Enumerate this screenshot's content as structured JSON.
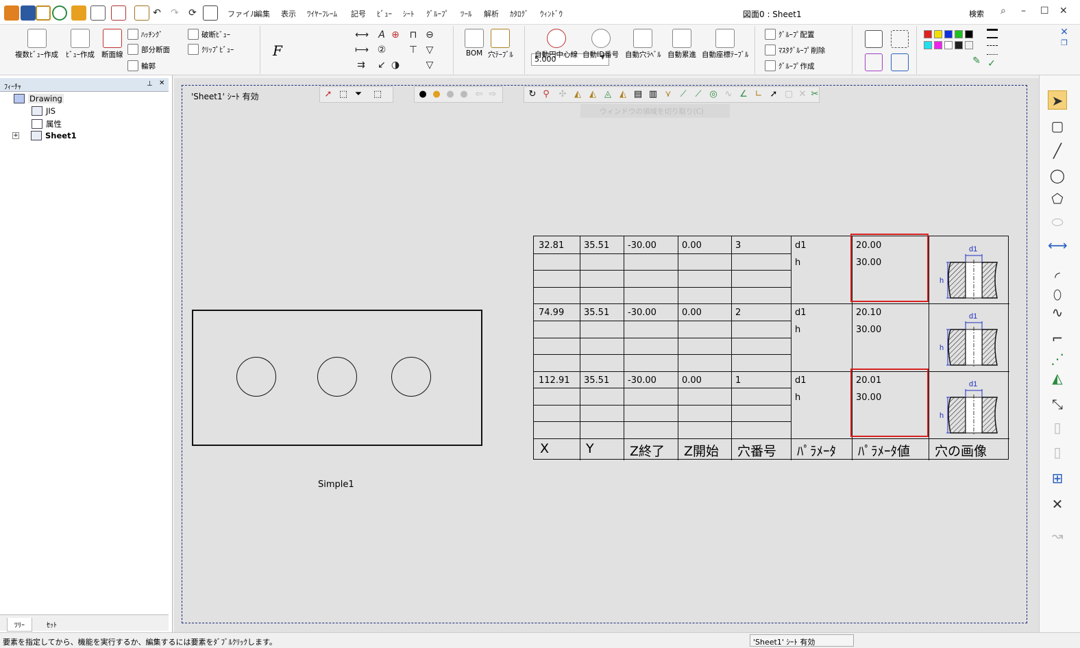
{
  "titlebar": {
    "document_title": "図面0 : Sheet1",
    "search_label": "検索",
    "menu": [
      "ファイル",
      "編集",
      "表示",
      "ﾜｲﾔｰﾌﾚｰﾑ",
      "記号",
      "ﾋﾞｭｰ",
      "ｼｰﾄ",
      "ｸﾞﾙｰﾌﾟ",
      "ﾂｰﾙ",
      "解析",
      "ｶﾀﾛｸﾞ",
      "ｳｨﾝﾄﾞｳ"
    ]
  },
  "ribbon": {
    "multi_view": "複数ﾋﾞｭｰ作成",
    "view_create": "ﾋﾞｭｰ作成",
    "section_line": "断面線",
    "hatching": "ﾊｯﾁﾝｸﾞ",
    "partial_section": "部分断面",
    "contour": "輪郭",
    "broken_view": "破断ﾋﾞｭｰ",
    "clip_view": "ｸﾘｯﾌﾟﾋﾞｭｰ",
    "scale_value": "5.000",
    "font_button": "F",
    "bom": "BOM",
    "hole_table": "穴ﾃｰﾌﾞﾙ",
    "auto_center": "自動円中心線",
    "auto_id": "自動ID番号",
    "auto_hole_label": "自動穴ﾗﾍﾞﾙ",
    "auto_ordinate": "自動累進",
    "auto_coord_table": "自動座標ﾃｰﾌﾞﾙ",
    "group_place": "ｸﾞﾙｰﾌﾟ配置",
    "master_group_delete": "ﾏｽﾀｸﾞﾙｰﾌﾟ削除",
    "group_create": "ｸﾞﾙｰﾌﾟ作成",
    "colors": [
      "#e02020",
      "#f0e000",
      "#1030e0",
      "#20c020",
      "#000000",
      "#20e0f0",
      "#f020f0",
      "#ffffff",
      "#202020",
      "#f0f0f0"
    ]
  },
  "feature_panel": {
    "title": "ﾌｨｰﾁｬ",
    "tree": [
      {
        "label": "Drawing",
        "icon": "drawing-icon"
      },
      {
        "label": "JIS",
        "icon": "standard-icon"
      },
      {
        "label": "属性",
        "icon": "attributes-icon"
      },
      {
        "label": "Sheet1",
        "icon": "sheet-icon"
      }
    ],
    "tabs": [
      "ﾂﾘｰ",
      "ｾｯﾄ"
    ]
  },
  "canvas": {
    "sheet_label": "'Sheet1' ｼｰﾄ 有効",
    "ghost_hint": "ウィンドウの領域を切り取り(C)",
    "view_name": "Simple1"
  },
  "hole_table": {
    "headers": [
      "X",
      "Y",
      "Z終了",
      "Z開始",
      "穴番号",
      "ﾊﾟﾗﾒｰﾀ",
      "ﾊﾟﾗﾒｰﾀ値",
      "穴の画像"
    ],
    "rows": [
      {
        "x": "32.81",
        "y": "35.51",
        "z_end": "-30.00",
        "z_start": "0.00",
        "hole_no": "3",
        "params": [
          "d1",
          "h"
        ],
        "values": [
          "20.00",
          "30.00"
        ]
      },
      {
        "x": "74.99",
        "y": "35.51",
        "z_end": "-30.00",
        "z_start": "0.00",
        "hole_no": "2",
        "params": [
          "d1",
          "h"
        ],
        "values": [
          "20.10",
          "30.00"
        ]
      },
      {
        "x": "112.91",
        "y": "35.51",
        "z_end": "-30.00",
        "z_start": "0.00",
        "hole_no": "1",
        "params": [
          "d1",
          "h"
        ],
        "values": [
          "20.01",
          "30.00"
        ]
      }
    ],
    "image_labels": {
      "diameter": "d1",
      "height": "h"
    }
  },
  "statusbar": {
    "message": "要素を指定してから、機能を実行するか、編集するには要素をﾀﾞﾌﾞﾙｸﾘｯｸします。",
    "mode": "'Sheet1' ｼｰﾄ 有効"
  }
}
